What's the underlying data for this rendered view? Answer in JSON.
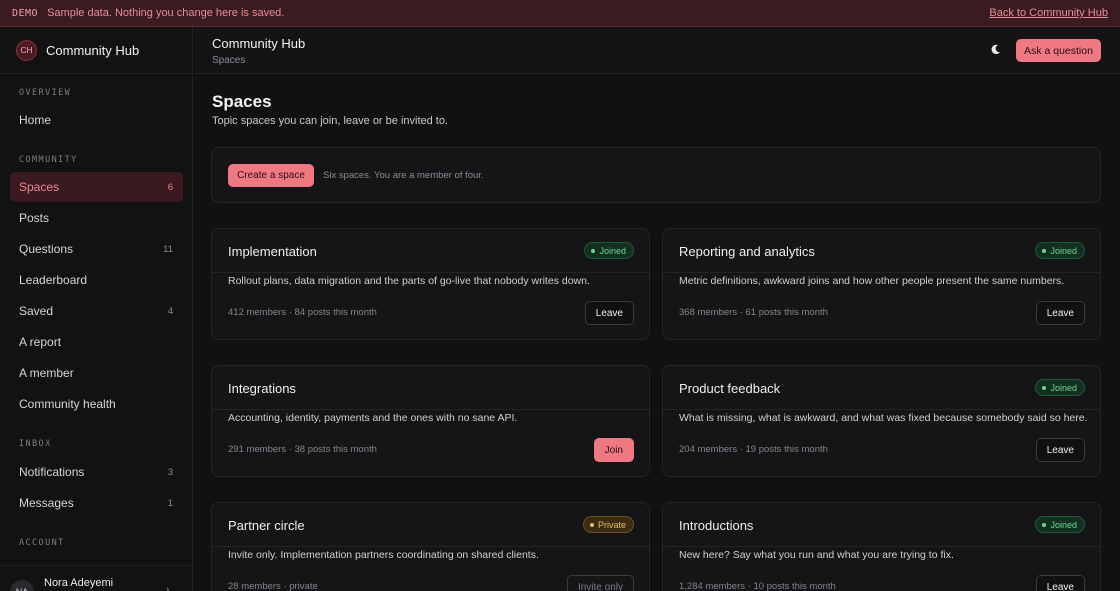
{
  "banner": {
    "tag": "DEMO",
    "message": "Sample data. Nothing you change here is saved.",
    "back_link": "Back to Community Hub"
  },
  "brand": {
    "initials": "CH",
    "name": "Community Hub"
  },
  "sidebar": {
    "sections": [
      "OVERVIEW",
      "COMMUNITY",
      "INBOX",
      "ACCOUNT"
    ],
    "overview": [
      {
        "label": "Home",
        "count": ""
      }
    ],
    "community": [
      {
        "label": "Spaces",
        "count": "6",
        "active": true
      },
      {
        "label": "Posts",
        "count": ""
      },
      {
        "label": "Questions",
        "count": "11"
      },
      {
        "label": "Leaderboard",
        "count": ""
      },
      {
        "label": "Saved",
        "count": "4"
      },
      {
        "label": "A report",
        "count": ""
      },
      {
        "label": "A member",
        "count": ""
      },
      {
        "label": "Community health",
        "count": ""
      }
    ],
    "inbox": [
      {
        "label": "Notifications",
        "count": "3"
      },
      {
        "label": "Messages",
        "count": "1"
      }
    ],
    "user": {
      "initials": "NA",
      "name": "Nora Adeyemi"
    }
  },
  "topbar": {
    "title": "Community Hub",
    "breadcrumb": "Spaces",
    "ask_label": "Ask a question"
  },
  "page": {
    "title": "Spaces",
    "subtitle": "Topic spaces you can join, leave or be invited to."
  },
  "actions": {
    "create_label": "Create a space",
    "note": "Six spaces. You are a member of four."
  },
  "spaces": [
    {
      "name": "Implementation",
      "badge": "Joined",
      "status": "joined",
      "description": "Rollout plans, data migration and the parts of go-live that nobody writes down.",
      "meta": "412 members · 84 posts this month",
      "action": "Leave"
    },
    {
      "name": "Reporting and analytics",
      "badge": "Joined",
      "status": "joined",
      "description": "Metric definitions, awkward joins and how other people present the same numbers.",
      "meta": "368 members · 61 posts this month",
      "action": "Leave"
    },
    {
      "name": "Integrations",
      "badge": "",
      "status": "none",
      "description": "Accounting, identity, payments and the ones with no sane API.",
      "meta": "291 members · 38 posts this month",
      "action": "Join"
    },
    {
      "name": "Product feedback",
      "badge": "Joined",
      "status": "joined",
      "description": "What is missing, what is awkward, and what was fixed because somebody said so here.",
      "meta": "204 members · 19 posts this month",
      "action": "Leave"
    },
    {
      "name": "Partner circle",
      "badge": "Private",
      "status": "private",
      "description": "Invite only. Implementation partners coordinating on shared clients.",
      "meta": "28 members · private",
      "action": "Invite only"
    },
    {
      "name": "Introductions",
      "badge": "Joined",
      "status": "joined",
      "description": "New here? Say what you run and what you are trying to fix.",
      "meta": "1,284 members · 10 posts this month",
      "action": "Leave"
    }
  ]
}
